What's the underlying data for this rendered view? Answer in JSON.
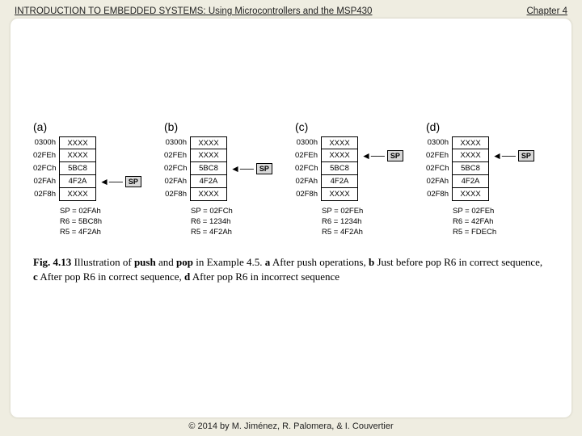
{
  "header": {
    "title": "INTRODUCTION TO EMBEDDED SYSTEMS: Using Microcontrollers and the MSP430",
    "chapter": "Chapter 4"
  },
  "footer": {
    "copyright": "© 2014 by M. Jiménez, R. Palomera, & I. Couvertier"
  },
  "sp_label": "SP",
  "panels": [
    {
      "label": "(a)",
      "rows": [
        {
          "addr": "0300h",
          "val": "XXXX",
          "sp": false
        },
        {
          "addr": "02FEh",
          "val": "XXXX",
          "sp": false
        },
        {
          "addr": "02FCh",
          "val": "5BC8",
          "sp": false
        },
        {
          "addr": "02FAh",
          "val": "4F2A",
          "sp": true
        },
        {
          "addr": "02F8h",
          "val": "XXXX",
          "sp": false
        }
      ],
      "regs": [
        "SP = 02FAh",
        "R6 = 5BC8h",
        "R5 = 4F2Ah"
      ]
    },
    {
      "label": "(b)",
      "rows": [
        {
          "addr": "0300h",
          "val": "XXXX",
          "sp": false
        },
        {
          "addr": "02FEh",
          "val": "XXXX",
          "sp": false
        },
        {
          "addr": "02FCh",
          "val": "5BC8",
          "sp": true
        },
        {
          "addr": "02FAh",
          "val": "4F2A",
          "sp": false
        },
        {
          "addr": "02F8h",
          "val": "XXXX",
          "sp": false
        }
      ],
      "regs": [
        "SP = 02FCh",
        "R6 = 1234h",
        "R5 = 4F2Ah"
      ]
    },
    {
      "label": "(c)",
      "rows": [
        {
          "addr": "0300h",
          "val": "XXXX",
          "sp": false
        },
        {
          "addr": "02FEh",
          "val": "XXXX",
          "sp": true
        },
        {
          "addr": "02FCh",
          "val": "5BC8",
          "sp": false
        },
        {
          "addr": "02FAh",
          "val": "4F2A",
          "sp": false
        },
        {
          "addr": "02F8h",
          "val": "XXXX",
          "sp": false
        }
      ],
      "regs": [
        "SP = 02FEh",
        "R6 = 1234h",
        "R5 = 4F2Ah"
      ]
    },
    {
      "label": "(d)",
      "rows": [
        {
          "addr": "0300h",
          "val": "XXXX",
          "sp": false
        },
        {
          "addr": "02FEh",
          "val": "XXXX",
          "sp": true
        },
        {
          "addr": "02FCh",
          "val": "5BC8",
          "sp": false
        },
        {
          "addr": "02FAh",
          "val": "4F2A",
          "sp": false
        },
        {
          "addr": "02F8h",
          "val": "XXXX",
          "sp": false
        }
      ],
      "regs": [
        "SP = 02FEh",
        "R6 = 42FAh",
        "R5 = FDECh"
      ]
    }
  ],
  "caption": {
    "figno": "Fig. 4.13",
    "prefix": "  Illustration of ",
    "b1": "push",
    "mid1": " and ",
    "b2": "pop",
    "mid2": " in Example 4.5. ",
    "pa": "a",
    "ta": " After push operations, ",
    "pb": "b",
    "tb": " Just before pop R6 in correct sequence, ",
    "pc": "c",
    "tc": " After pop R6 in correct sequence, ",
    "pd": "d",
    "td": " After pop R6 in incorrect sequence"
  }
}
